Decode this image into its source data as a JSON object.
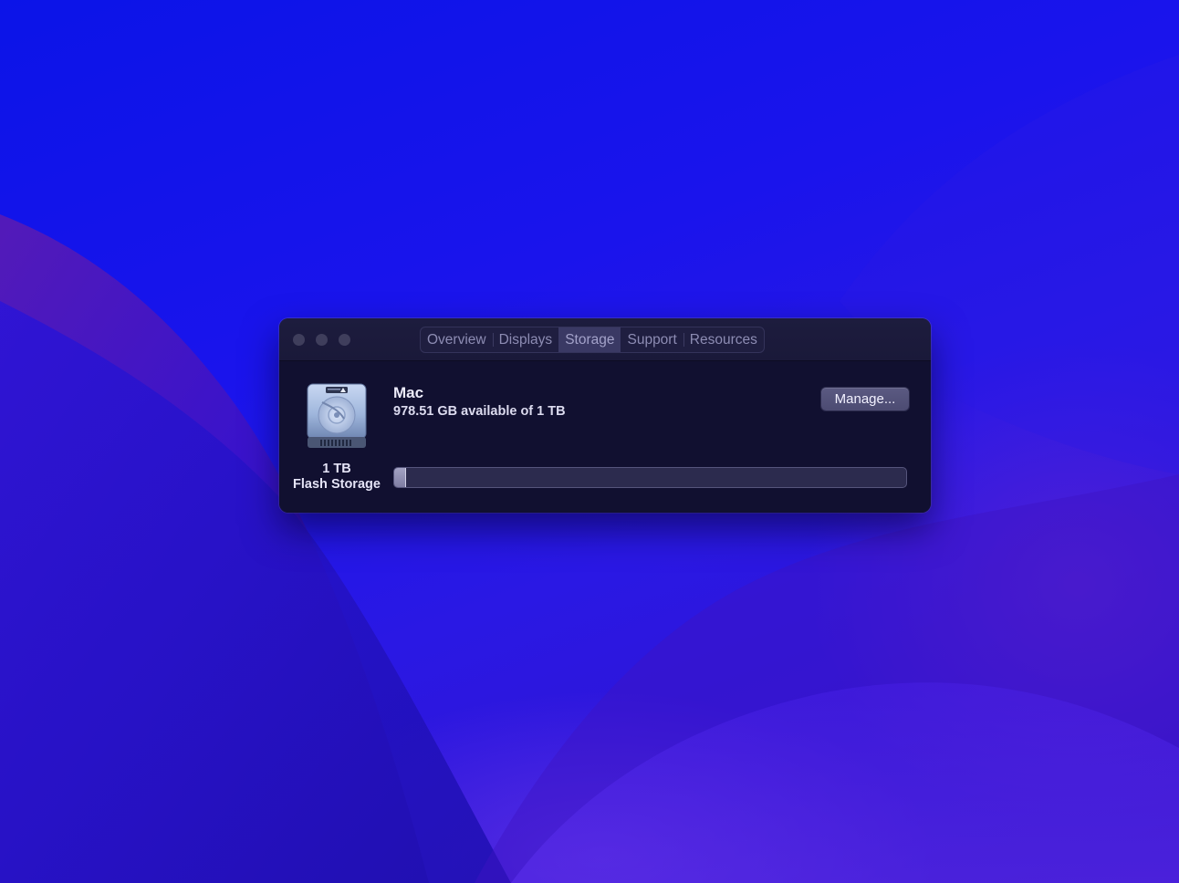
{
  "window": {
    "tabs": [
      {
        "label": "Overview",
        "active": false
      },
      {
        "label": "Displays",
        "active": false
      },
      {
        "label": "Storage",
        "active": true
      },
      {
        "label": "Support",
        "active": false
      },
      {
        "label": "Resources",
        "active": false
      }
    ]
  },
  "storage": {
    "disk_capacity": "1 TB",
    "disk_type": "Flash Storage",
    "volume_name": "Mac",
    "availability": "978.51 GB available of 1 TB",
    "used_fraction": 0.0215,
    "manage_label": "Manage..."
  },
  "colors": {
    "window_bg": "#151532",
    "accent_tab": "#3a3964",
    "wallpaper_primary": "#1a14ec"
  },
  "icons": {
    "disk": "internal-disk-icon"
  }
}
